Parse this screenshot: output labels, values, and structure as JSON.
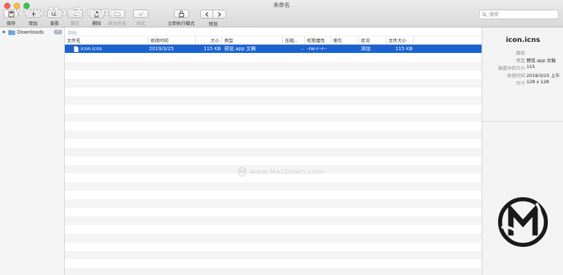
{
  "window": {
    "title": "未命名"
  },
  "toolbar": {
    "save": "保存",
    "add": "增加",
    "view": "查看",
    "extract": "解压",
    "delete": "删除",
    "new_folder": "新文件夹",
    "test": "测试",
    "instant_mode": "立即执行模式",
    "goto": "转到"
  },
  "search": {
    "placeholder": "搜索"
  },
  "sidebar": {
    "items": [
      {
        "label": "Downloads",
        "count": "0"
      }
    ]
  },
  "table": {
    "section": "存档",
    "columns": [
      "文件名",
      "修改时间",
      "大小",
      "类型",
      "压缩...",
      "权限属性",
      "索引",
      "状况",
      "文件大小"
    ],
    "rows": [
      {
        "name": "icon.icns",
        "modified": "2019/3/25",
        "size": "115 KB",
        "type": "预览.app 文稿",
        "compressed": "–",
        "permissions": "-rw-r--r--",
        "index": "",
        "status": "添加",
        "file_size": "115 KB"
      }
    ]
  },
  "inspector": {
    "title": "icon.icns",
    "fields": [
      {
        "key": "路径",
        "value": ""
      },
      {
        "key": "类型",
        "value": "预览.app 文稿"
      },
      {
        "key": "磁盘中的大小",
        "value": "115"
      },
      {
        "key": "修改时间",
        "value": "2019/3/25 上午"
      },
      {
        "key": "尺寸",
        "value": "128 x 128"
      }
    ]
  },
  "watermarks": {
    "center": "www.MacDown.com",
    "top": "www.MacZ.com"
  },
  "colors": {
    "selection": "#1b63d1",
    "toolbar_bg": "#dcdcdc",
    "sidebar_bg": "#f5f5f5",
    "inspector_bg": "#f3f3f3"
  }
}
